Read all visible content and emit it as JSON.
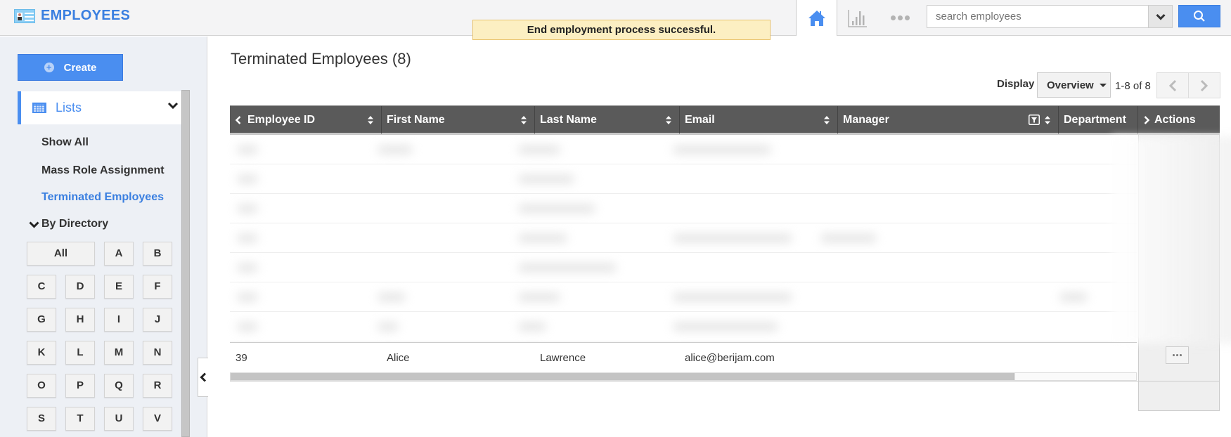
{
  "app": {
    "title": "EMPLOYEES"
  },
  "notification": {
    "text": "End employment process successful.",
    "type": "success"
  },
  "nav": {
    "tabs": [
      {
        "name": "home",
        "icon": "home-icon",
        "active": true
      },
      {
        "name": "analytics",
        "icon": "bar-chart-icon",
        "active": false
      },
      {
        "name": "more",
        "icon": "more-dots-icon",
        "active": false
      }
    ]
  },
  "search": {
    "value": "",
    "placeholder": "search employees"
  },
  "sidebar": {
    "create_label": "Create",
    "lists_label": "Lists",
    "links": [
      {
        "label": "Show All",
        "active": false
      },
      {
        "label": "Mass Role Assignment",
        "active": false
      },
      {
        "label": "Terminated Employees",
        "active": true
      }
    ],
    "directory_label": "By Directory",
    "letters": [
      "All",
      "A",
      "B",
      "C",
      "D",
      "E",
      "F",
      "G",
      "H",
      "I",
      "J",
      "K",
      "L",
      "M",
      "N",
      "O",
      "P",
      "Q",
      "R",
      "S",
      "T",
      "U",
      "V"
    ]
  },
  "main": {
    "title": "Terminated Employees (8)",
    "display_label": "Display",
    "display_value": "Overview",
    "pager_text": "1-8 of 8",
    "table": {
      "columns": [
        "Employee ID",
        "First Name",
        "Last Name",
        "Email",
        "Manager",
        "Department",
        "Actions"
      ],
      "blurred_rows": 7,
      "rows": [
        {
          "employee_id": "39",
          "first_name": "Alice",
          "last_name": "Lawrence",
          "email": "alice@berijam.com",
          "manager": "",
          "department": ""
        }
      ]
    }
  },
  "colors": {
    "accent": "#4a8ef0",
    "brand": "#3a7fe0",
    "header_bg": "#5a5a5a",
    "notify_bg": "#fcefc2"
  }
}
